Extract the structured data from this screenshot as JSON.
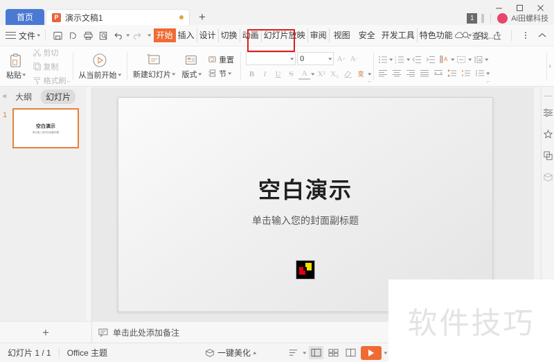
{
  "titlebar": {
    "home_tab": "首页",
    "doc_tab": "演示文稿1",
    "doc_icon": "ppt-file-icon",
    "add_tab_label": "+",
    "minimize": "minimize-icon",
    "maximize": "maximize-icon",
    "close": "close-icon",
    "notify_count": "1",
    "account_name": "Ai田螺科技"
  },
  "menubar": {
    "file_label": "文件",
    "quick_icons": [
      "save-icon",
      "save-as-icon",
      "print-icon",
      "print-preview-icon",
      "undo-icon",
      "redo-icon",
      "customize-icon"
    ],
    "tabs": [
      {
        "label": "开始",
        "active": true
      },
      {
        "label": "插入",
        "active": false
      },
      {
        "label": "设计",
        "active": false
      },
      {
        "label": "切换",
        "active": false
      },
      {
        "label": "动画",
        "active": false
      },
      {
        "label": "幻灯片放映",
        "active": false
      },
      {
        "label": "审阅",
        "active": false
      },
      {
        "label": "视图",
        "active": false
      },
      {
        "label": "安全",
        "active": false
      },
      {
        "label": "开发工具",
        "active": false
      },
      {
        "label": "特色功能",
        "active": false
      }
    ],
    "find_label": "查找...",
    "right_icons": [
      "cloud-icon",
      "add-user-icon",
      "share-icon",
      "more-icon",
      "collapse-ribbon-icon"
    ],
    "highlight_color": "#e01b1b"
  },
  "ribbon": {
    "clipboard": {
      "paste": "粘贴",
      "cut": "剪切",
      "copy": "复制",
      "format_painter": "格式刷"
    },
    "present": {
      "from_current": "从当前开始"
    },
    "slides": {
      "new_slide": "新建幻灯片",
      "layout": "版式",
      "reset": "重置",
      "section": "节"
    },
    "font": {
      "name_value": "",
      "size_value": "0",
      "grow": "A",
      "shrink": "A",
      "bold": "B",
      "italic": "I",
      "underline": "U",
      "strike": "S",
      "font_color": "A",
      "superscript": "X²",
      "subscript": "X₂",
      "clear_format": "clear-format-icon",
      "change_case": "变"
    }
  },
  "leftpanel": {
    "collapse": "«",
    "tab_outline": "大纲",
    "tab_slides": "幻灯片",
    "slide_number": "1",
    "thumb_title": "空白演示",
    "thumb_subtitle": "单击输入您的封面副标题"
  },
  "slide": {
    "title": "空白演示",
    "subtitle": "单击输入您的封面副标题",
    "logo_name": "slide-logo-image",
    "logo_colors": {
      "bg": "#000000",
      "red": "#e60012",
      "yellow": "#f5e200"
    }
  },
  "rightbar": {
    "icons": [
      "slide-settings-icon",
      "design-ideas-icon",
      "shapes-icon",
      "material-library-icon"
    ]
  },
  "notes": {
    "add_slide": "+",
    "placeholder": "单击此处添加备注",
    "note_icon": "note-icon"
  },
  "statusbar": {
    "slide_count": "幻灯片 1 / 1",
    "theme": "Office 主题",
    "beautify": "一键美化",
    "beautify_icon": "beautify-icon",
    "view_normal": "normal-view-icon",
    "view_sorter": "slide-sorter-icon",
    "view_reading": "reading-view-icon",
    "play_icon": "play-icon",
    "text_direction_icon": "text-direction-icon"
  },
  "watermark": {
    "text": "软件技巧"
  }
}
